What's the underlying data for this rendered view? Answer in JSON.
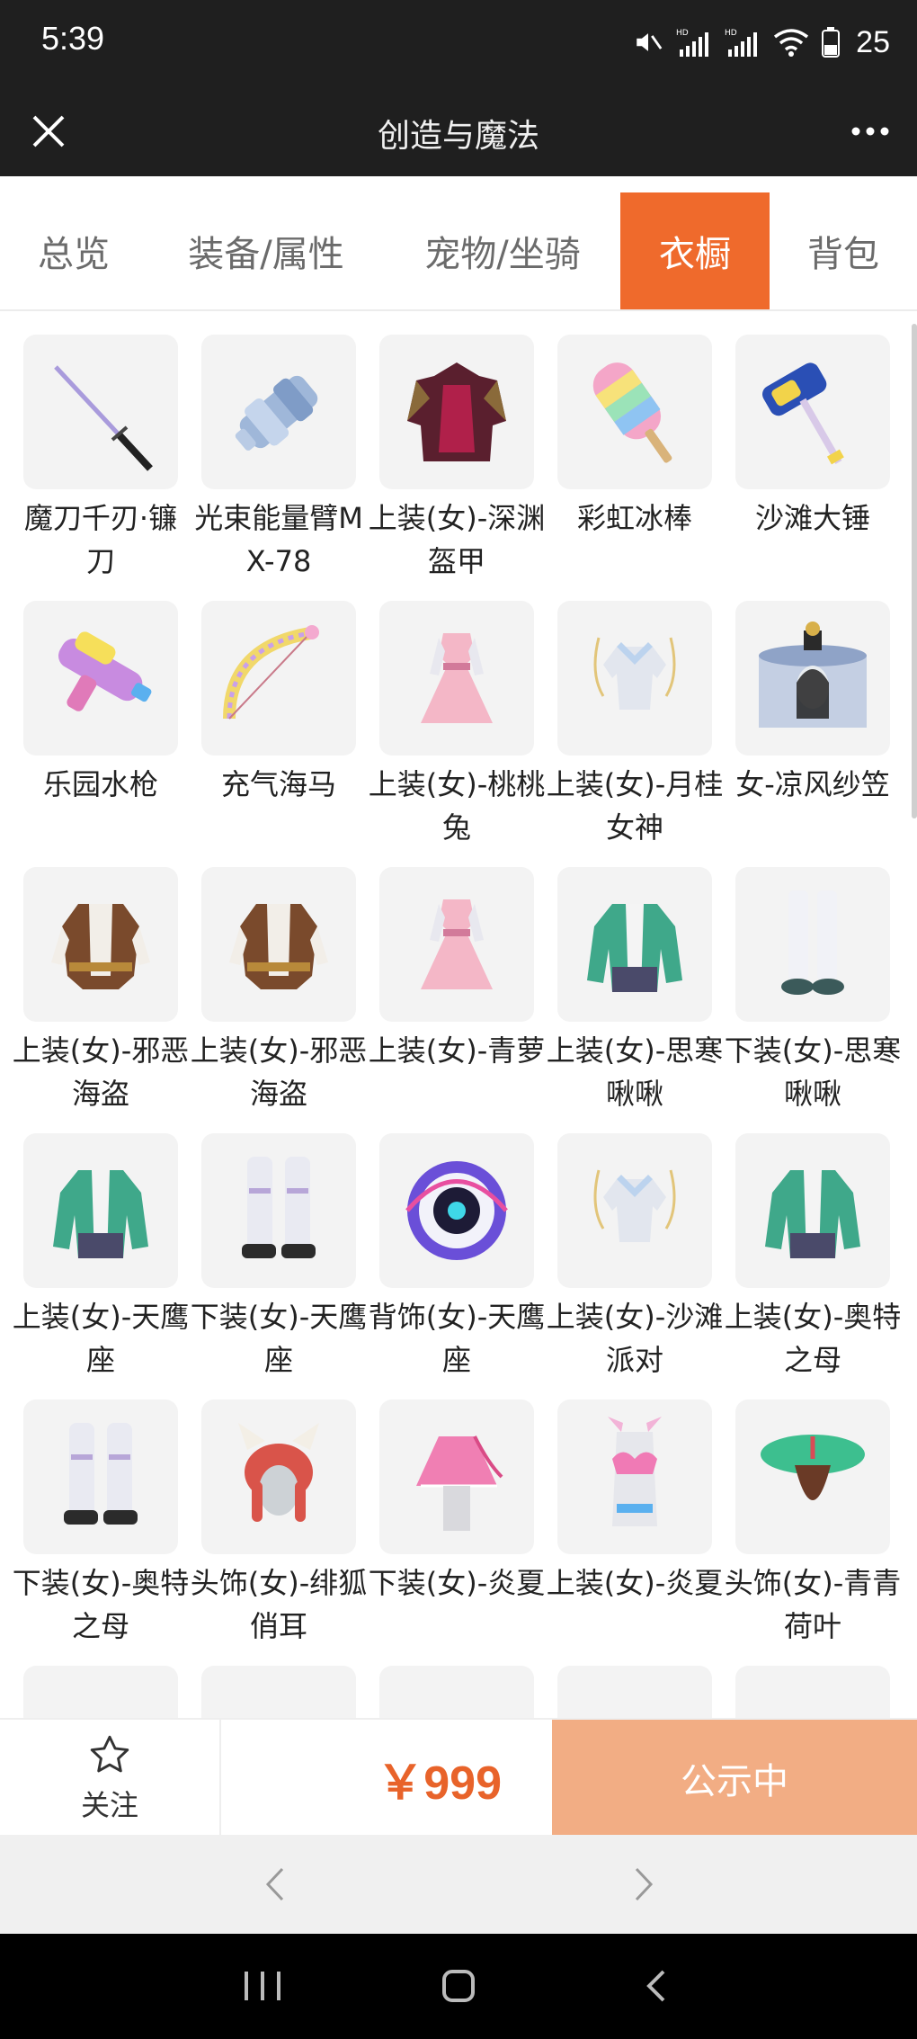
{
  "status_bar": {
    "time": "5:39",
    "battery": "25",
    "icons": [
      "mute-icon",
      "hd-signal-icon",
      "hd-signal-icon",
      "wifi-icon",
      "battery-icon"
    ]
  },
  "header": {
    "title": "创造与魔法",
    "close_icon": "close-icon",
    "more_icon": "more-icon"
  },
  "tabs": [
    {
      "label": "总览",
      "active": false
    },
    {
      "label": "装备/属性",
      "active": false
    },
    {
      "label": "宠物/坐骑",
      "active": false
    },
    {
      "label": "衣橱",
      "active": true
    },
    {
      "label": "背包",
      "active": false
    }
  ],
  "items": [
    {
      "name": "魔刀千刃·镰刀",
      "icon": "katana-icon"
    },
    {
      "name": "光束能量臂MX-78",
      "icon": "energy-arm-icon"
    },
    {
      "name": "上装(女)-深渊盔甲",
      "icon": "armor-icon"
    },
    {
      "name": "彩虹冰棒",
      "icon": "popsicle-icon"
    },
    {
      "name": "沙滩大锤",
      "icon": "hammer-icon"
    },
    {
      "name": "乐园水枪",
      "icon": "water-gun-icon"
    },
    {
      "name": "充气海马",
      "icon": "bow-icon"
    },
    {
      "name": "上装(女)-桃桃兔",
      "icon": "dress-icon"
    },
    {
      "name": "上装(女)-月桂女神",
      "icon": "top-icon"
    },
    {
      "name": "女-凉风纱笠",
      "icon": "hat-veil-icon"
    },
    {
      "name": "上装(女)-邪恶海盗",
      "icon": "pirate-top-icon"
    },
    {
      "name": "上装(女)-邪恶海盗",
      "icon": "pirate-top-icon"
    },
    {
      "name": "上装(女)-青萝",
      "icon": "dress-icon"
    },
    {
      "name": "上装(女)-思寒啾啾",
      "icon": "jacket-icon"
    },
    {
      "name": "下装(女)-思寒啾啾",
      "icon": "pants-icon"
    },
    {
      "name": "上装(女)-天鹰座",
      "icon": "jacket-icon"
    },
    {
      "name": "下装(女)-天鹰座",
      "icon": "boots-icon"
    },
    {
      "name": "背饰(女)-天鹰座",
      "icon": "backpack-icon"
    },
    {
      "name": "上装(女)-沙滩派对",
      "icon": "top-icon"
    },
    {
      "name": "上装(女)-奥特之母",
      "icon": "jacket-icon"
    },
    {
      "name": "下装(女)-奥特之母",
      "icon": "boots-icon"
    },
    {
      "name": "头饰(女)-绯狐俏耳",
      "icon": "fox-ears-icon"
    },
    {
      "name": "下装(女)-炎夏",
      "icon": "skirt-icon"
    },
    {
      "name": "上装(女)-炎夏",
      "icon": "bikini-icon"
    },
    {
      "name": "头饰(女)-青青荷叶",
      "icon": "lotus-leaf-icon"
    },
    {
      "name": "",
      "icon": "partial-item-icon"
    },
    {
      "name": "",
      "icon": "partial-item-icon"
    },
    {
      "name": "",
      "icon": "partial-item-icon"
    },
    {
      "name": "",
      "icon": "partial-item-icon"
    },
    {
      "name": "",
      "icon": "partial-item-icon"
    }
  ],
  "action_bar": {
    "follow_label": "关注",
    "price": "￥999",
    "status_button": "公示中"
  },
  "colors": {
    "accent": "#ef6a2c",
    "price": "#e8632a",
    "status_button_bg": "#f2ad84",
    "header_bg": "#1f1f1f"
  }
}
